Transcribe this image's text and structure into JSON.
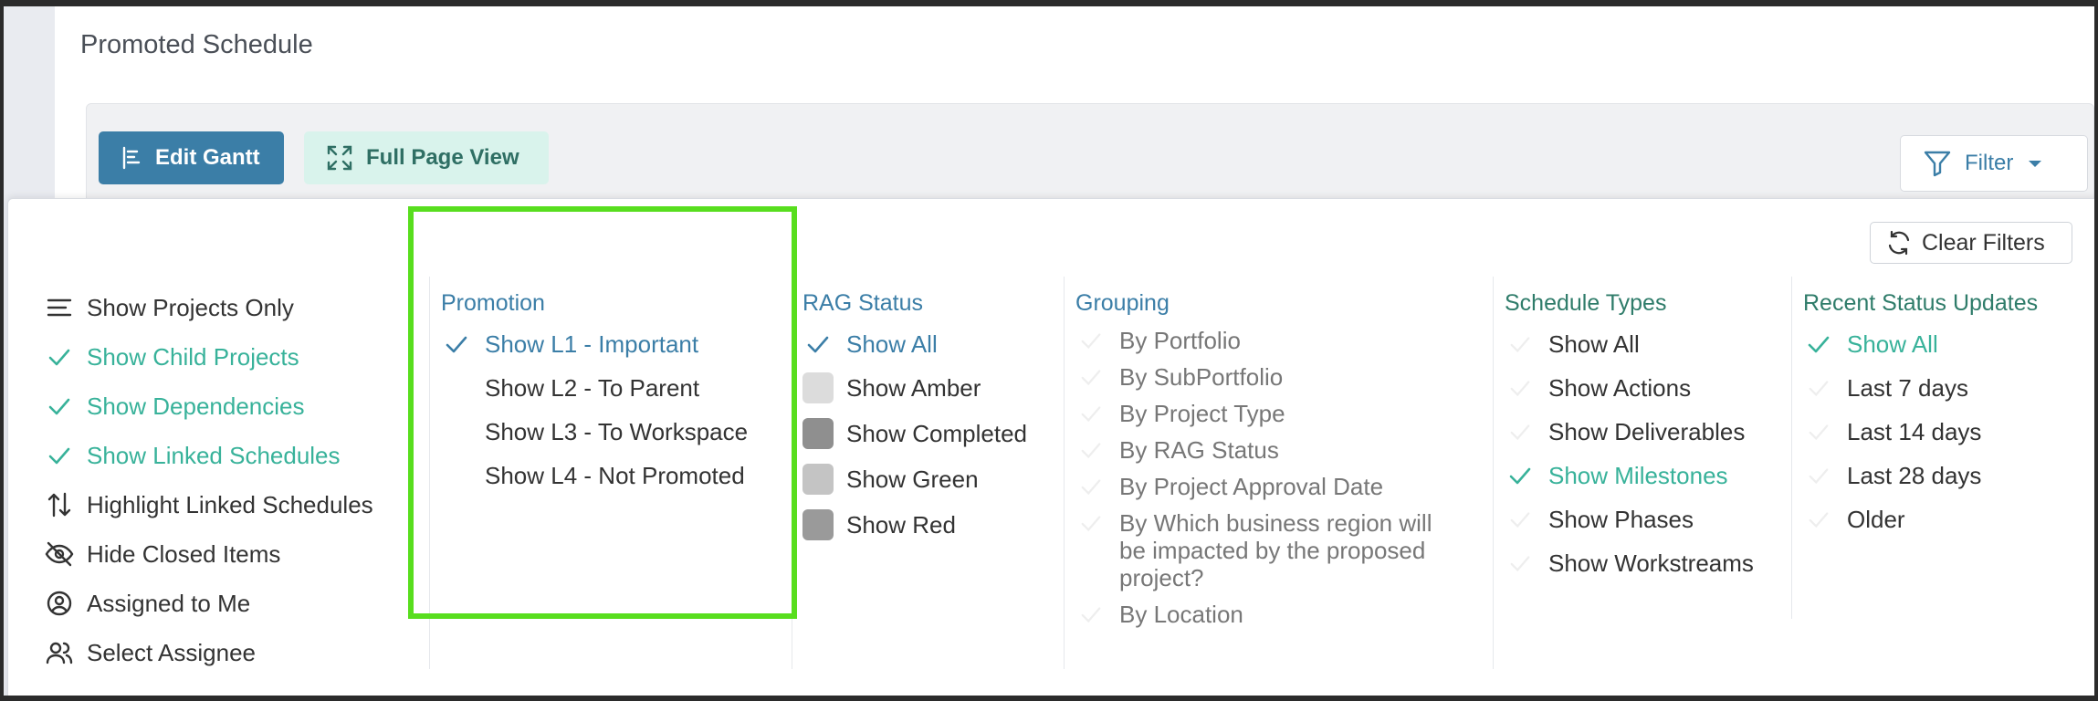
{
  "page": {
    "title": "Promoted Schedule"
  },
  "toolbar": {
    "edit_gantt": "Edit Gantt",
    "full_page": "Full Page View",
    "filter": "Filter"
  },
  "filters": {
    "clear_label": "Clear Filters",
    "options": [
      {
        "label": "Show Projects Only",
        "icon": "list-icon",
        "active": false
      },
      {
        "label": "Show Child Projects",
        "icon": "check-icon",
        "active": true
      },
      {
        "label": "Show Dependencies",
        "icon": "check-icon",
        "active": true
      },
      {
        "label": "Show Linked Schedules",
        "icon": "check-icon",
        "active": true
      },
      {
        "label": "Highlight Linked Schedules",
        "icon": "sort-arrows-icon",
        "active": false
      },
      {
        "label": "Hide Closed Items",
        "icon": "eye-off-icon",
        "active": false
      },
      {
        "label": "Assigned to Me",
        "icon": "user-circle-icon",
        "active": false
      },
      {
        "label": "Select Assignee",
        "icon": "users-icon",
        "active": false
      }
    ],
    "promotion": {
      "title": "Promotion",
      "items": [
        {
          "label": "Show L1 - Important",
          "checked": true
        },
        {
          "label": "Show L2 - To Parent",
          "checked": false
        },
        {
          "label": "Show L3 - To Workspace",
          "checked": false
        },
        {
          "label": "Show L4 - Not Promoted",
          "checked": false
        }
      ]
    },
    "rag": {
      "title": "RAG Status",
      "items": [
        {
          "label": "Show All",
          "checked": true,
          "swatch": ""
        },
        {
          "label": "Show Amber",
          "checked": false,
          "swatch": "#dcdcdc"
        },
        {
          "label": "Show Completed",
          "checked": false,
          "swatch": "#8f8f8f"
        },
        {
          "label": "Show Green",
          "checked": false,
          "swatch": "#c4c4c4"
        },
        {
          "label": "Show Red",
          "checked": false,
          "swatch": "#9a9a9a"
        }
      ]
    },
    "grouping": {
      "title": "Grouping",
      "items": [
        {
          "label": "By Portfolio",
          "checked": false
        },
        {
          "label": "By SubPortfolio",
          "checked": false
        },
        {
          "label": "By Project Type",
          "checked": false
        },
        {
          "label": "By RAG Status",
          "checked": false
        },
        {
          "label": "By Project Approval Date",
          "checked": false
        },
        {
          "label": "By Which business region will be impacted by the proposed project?",
          "checked": false
        },
        {
          "label": "By Location",
          "checked": false
        }
      ]
    },
    "schedule_types": {
      "title": "Schedule Types",
      "items": [
        {
          "label": "Show All",
          "checked": false
        },
        {
          "label": "Show Actions",
          "checked": false
        },
        {
          "label": "Show Deliverables",
          "checked": false
        },
        {
          "label": "Show Milestones",
          "checked": true
        },
        {
          "label": "Show Phases",
          "checked": false
        },
        {
          "label": "Show Workstreams",
          "checked": false
        }
      ]
    },
    "recent": {
      "title": "Recent Status Updates",
      "items": [
        {
          "label": "Show All",
          "checked": true
        },
        {
          "label": "Last 7 days",
          "checked": false
        },
        {
          "label": "Last 14 days",
          "checked": false
        },
        {
          "label": "Last 28 days",
          "checked": false
        },
        {
          "label": "Older",
          "checked": false
        }
      ]
    }
  },
  "colors": {
    "primary": "#3b7ea7",
    "teal": "#38b29a",
    "grouping_blue": "#3b7ea7",
    "highlight": "#58de1e"
  }
}
